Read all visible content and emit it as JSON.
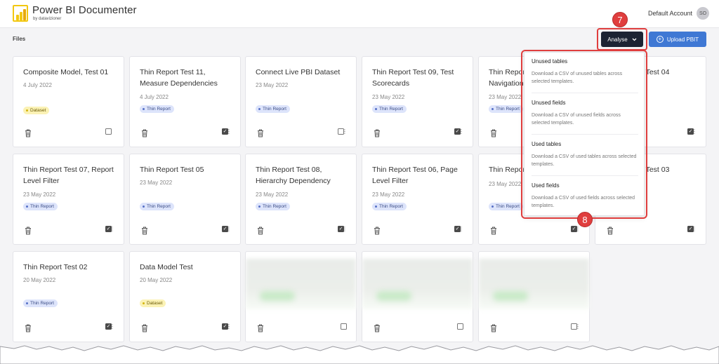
{
  "app": {
    "title": "Power BI Documenter",
    "subtitle": "by datavizioner",
    "account_name": "Default Account",
    "account_initials": "SO"
  },
  "toolbar": {
    "files_label": "Files",
    "analyse_label": "Analyse",
    "upload_label": "Upload PBIT"
  },
  "cards": [
    {
      "title": "Composite Model, Test 01",
      "date": "4 July 2022",
      "badge": "Dataset",
      "checked": false
    },
    {
      "title": "Thin Report Test 11, Measure Dependencies",
      "date": "4 July 2022",
      "badge": "Thin Report",
      "checked": true
    },
    {
      "title": "Connect Live PBI Dataset",
      "date": "23 May 2022",
      "badge": "Thin Report",
      "checked": false
    },
    {
      "title": "Thin Report Test 09, Test Scorecards",
      "date": "23 May 2022",
      "badge": "Thin Report",
      "checked": true
    },
    {
      "title": "Thin Report Test 10, Page Navigation",
      "date": "23 May 2022",
      "badge": "Thin Report",
      "checked": true
    },
    {
      "title": "Thin Report Test 04",
      "date": "",
      "badge": "",
      "checked": true
    },
    {
      "title": "Thin Report Test 07, Report Level Filter",
      "date": "23 May 2022",
      "badge": "Thin Report",
      "checked": true
    },
    {
      "title": "Thin Report Test 05",
      "date": "23 May 2022",
      "badge": "Thin Report",
      "checked": true
    },
    {
      "title": "Thin Report Test 08, Hierarchy Dependency",
      "date": "23 May 2022",
      "badge": "Thin Report",
      "checked": true
    },
    {
      "title": "Thin Report Test 06, Page Level Filter",
      "date": "23 May 2022",
      "badge": "Thin Report",
      "checked": true
    },
    {
      "title": "Thin Report",
      "date": "23 May 2022",
      "badge": "Thin Report",
      "checked": true
    },
    {
      "title": "Thin Report Test 03",
      "date": "",
      "badge": "",
      "checked": true
    },
    {
      "title": "Thin Report Test 02",
      "date": "20 May 2022",
      "badge": "Thin Report",
      "checked": true
    },
    {
      "title": "Data Model Test",
      "date": "20 May 2022",
      "badge": "Dataset",
      "checked": true
    }
  ],
  "dropdown": {
    "items": [
      {
        "title": "Unused tables",
        "description": "Download a CSV of unused tables across selected templates."
      },
      {
        "title": "Unused fields",
        "description": "Download a CSV of unused fields across selected templates."
      },
      {
        "title": "Used tables",
        "description": "Download a CSV of used tables across selected templates."
      },
      {
        "title": "Used fields",
        "description": "Download a CSV of used fields across selected templates."
      }
    ]
  },
  "callouts": {
    "analyse": "7",
    "menu": "8"
  },
  "colors": {
    "accent": "#3f78d4",
    "dark_button": "#1c2333",
    "highlight": "#e03e3e",
    "logo": "#f2c811"
  }
}
